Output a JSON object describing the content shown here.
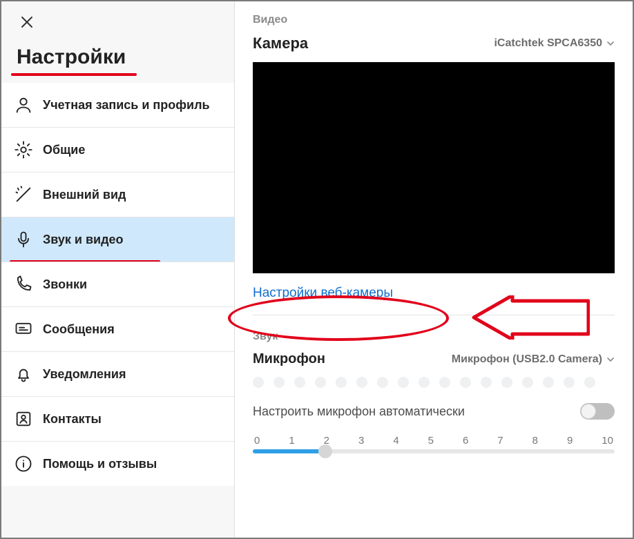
{
  "sidebar": {
    "title": "Настройки",
    "items": [
      {
        "label": "Учетная запись и профиль"
      },
      {
        "label": "Общие"
      },
      {
        "label": "Внешний вид"
      },
      {
        "label": "Звук и видео"
      },
      {
        "label": "Звонки"
      },
      {
        "label": "Сообщения"
      },
      {
        "label": "Уведомления"
      },
      {
        "label": "Контакты"
      },
      {
        "label": "Помощь и отзывы"
      }
    ]
  },
  "video": {
    "header": "Видео",
    "camera_label": "Камера",
    "camera_device": "iCatchtek SPCA6350",
    "webcam_settings": "Настройки веб-камеры"
  },
  "audio": {
    "header": "Звук",
    "mic_label": "Микрофон",
    "mic_device": "Микрофон (USB2.0 Camera)",
    "auto_adjust": "Настроить микрофон автоматически",
    "auto_adjust_on": false,
    "scale": [
      "0",
      "1",
      "2",
      "3",
      "4",
      "5",
      "6",
      "7",
      "8",
      "9",
      "10"
    ],
    "slider_value": 2
  }
}
